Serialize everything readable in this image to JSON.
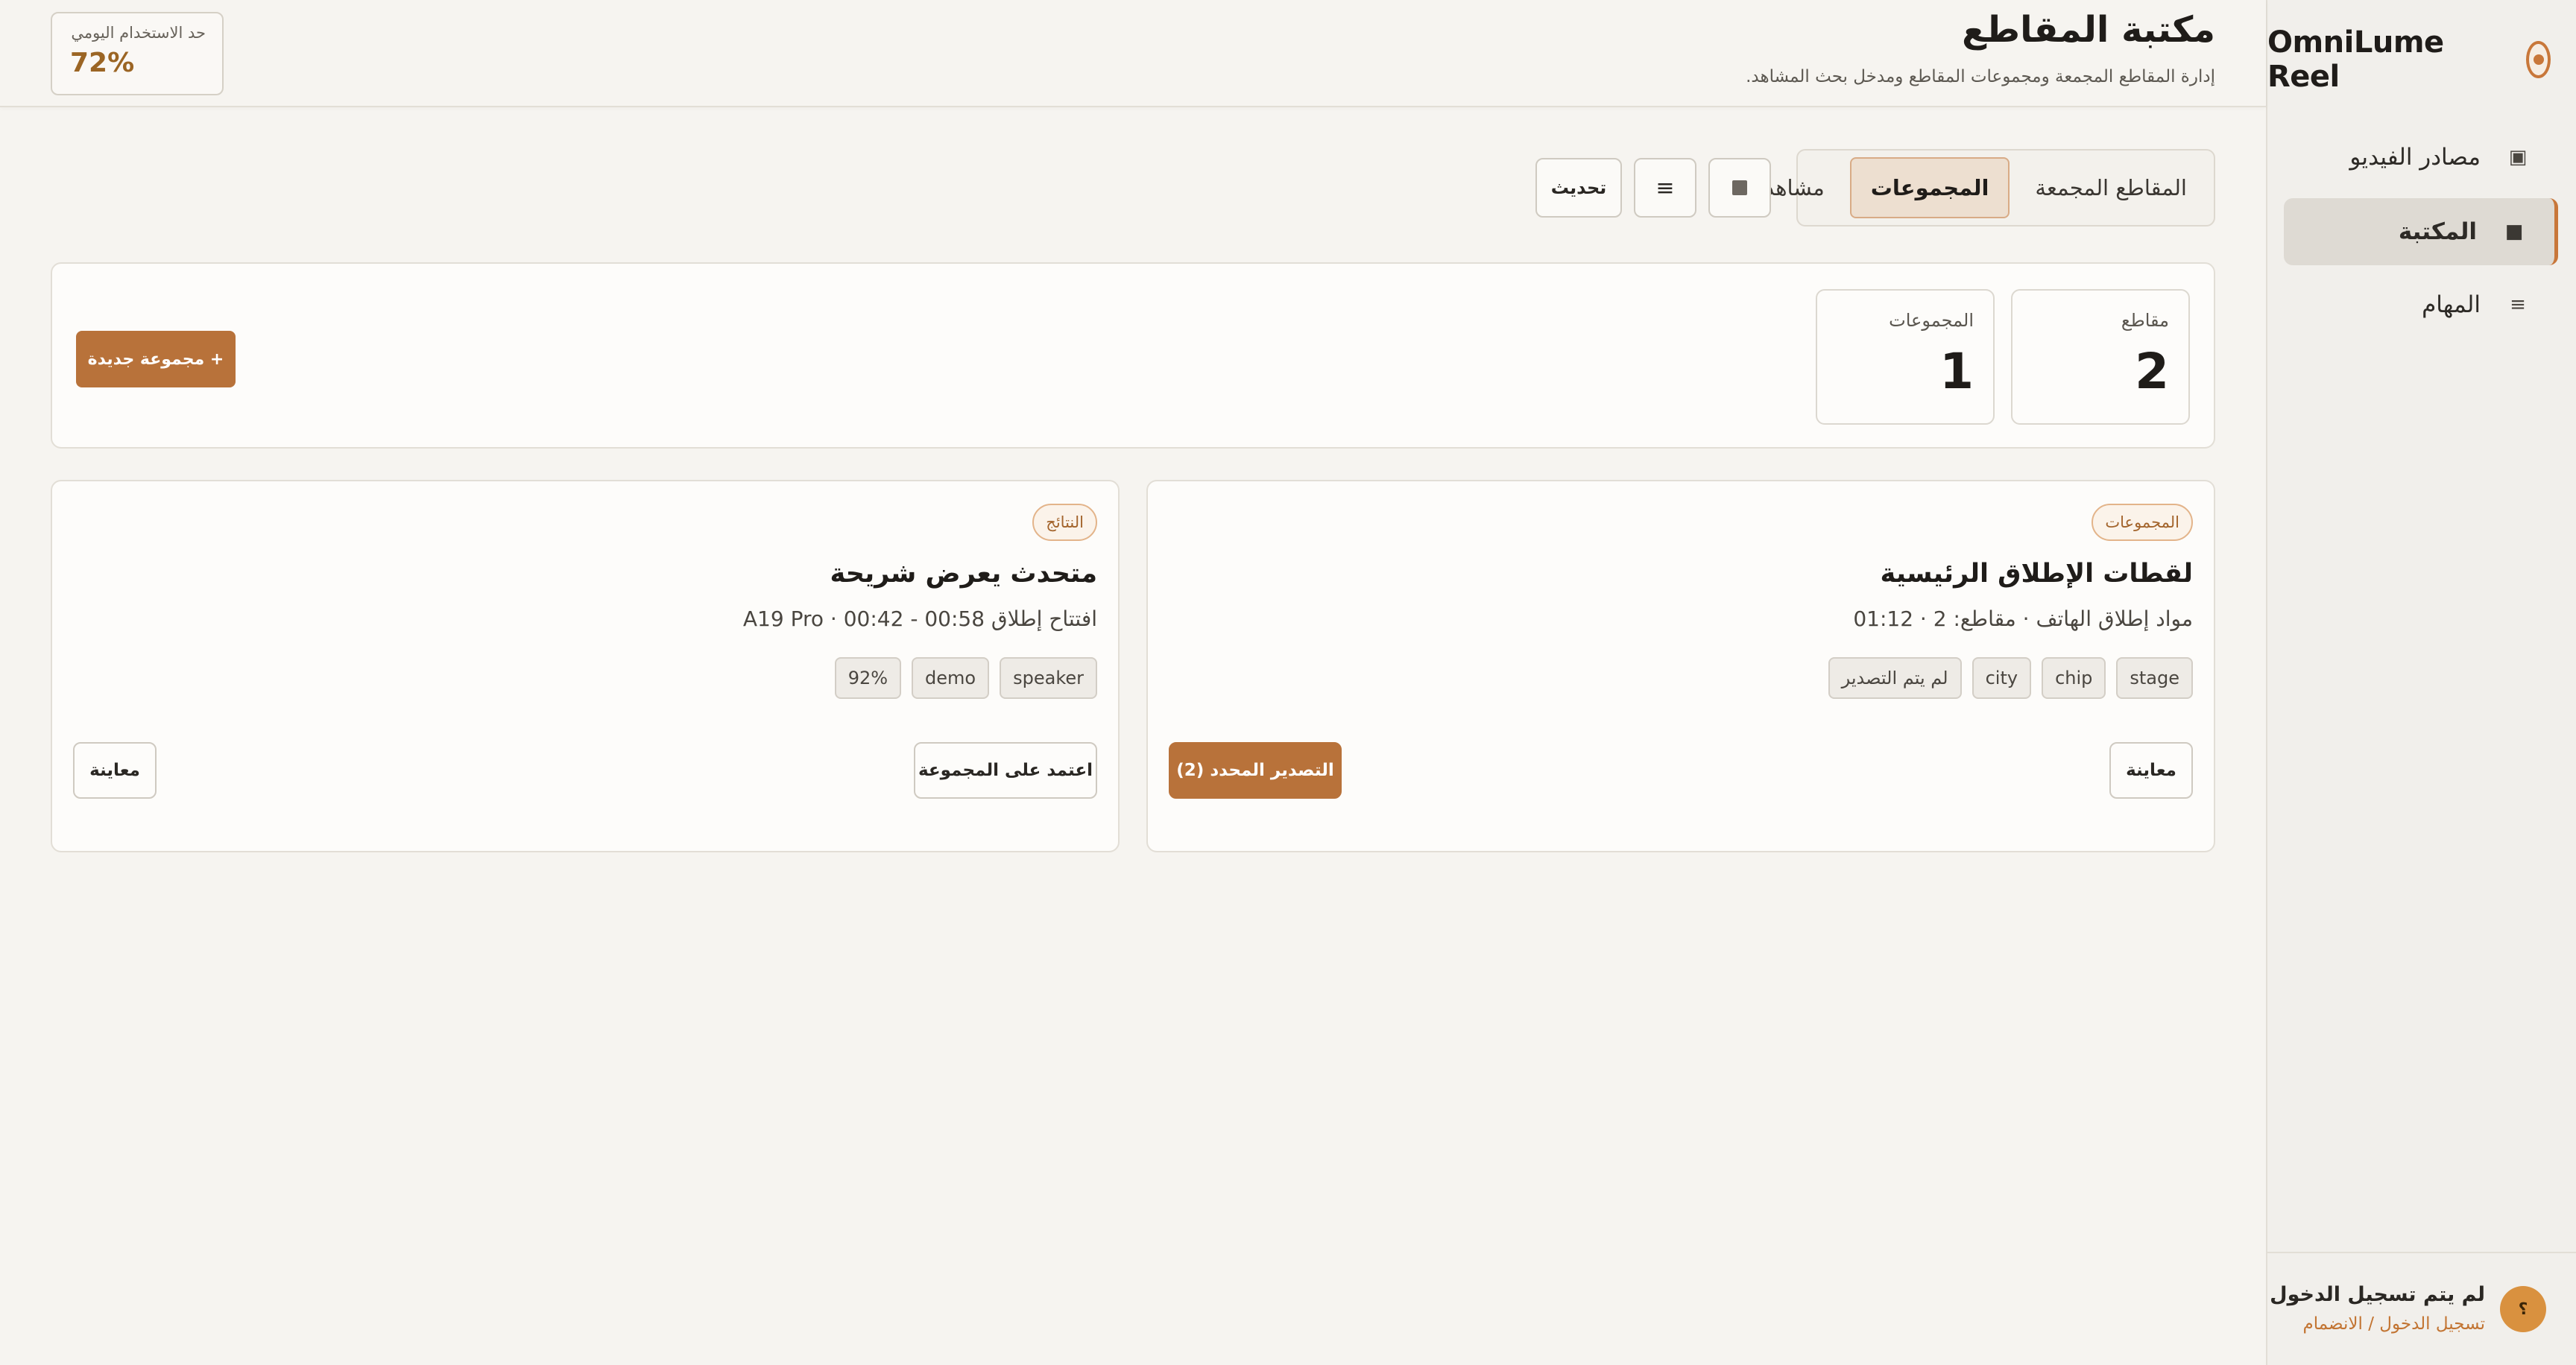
{
  "app": {
    "brand_name": "OmniLume Reel",
    "brand_icon": "lens-icon"
  },
  "sidebar": {
    "items": [
      {
        "label": "مصادر الفيديو",
        "icon": "▣"
      },
      {
        "label": "المكتبة",
        "icon": "■",
        "active": true
      },
      {
        "label": "المهام",
        "icon": "≡"
      }
    ],
    "user": {
      "avatar": "؟",
      "name": "لم يتم تسجيل الدخول",
      "login_link": "تسجيل الدخول / الانضمام"
    }
  },
  "header": {
    "title": "مكتبة المقاطع",
    "subtitle": "إدارة المقاطع المجمعة ومجموعات المقاطع ومدخل بحث المشاهد.",
    "usage_label": "حد الاستخدام اليومي",
    "usage_value": "72%"
  },
  "toolbar": {
    "tabs": [
      {
        "label": "المقاطع المجمعة"
      },
      {
        "label": "المجموعات",
        "active": true
      },
      {
        "label": "مشاهد"
      }
    ],
    "grid_icon": "grid-view-icon",
    "list_icon": "≡",
    "refresh_label": "تحديث"
  },
  "stats": {
    "clips_label": "مقاطع",
    "clips_value": "2",
    "groups_label": "المجموعات",
    "groups_value": "1",
    "new_group_label": "+ مجموعة جديدة"
  },
  "cards": [
    {
      "badge": "المجموعات",
      "title": "لقطات الإطلاق الرئيسية",
      "meta": "مواد إطلاق الهاتف · مقاطع: 2 · 01:12",
      "tags": [
        "stage",
        "chip",
        "city",
        "لم يتم التصدير"
      ],
      "preview_label": "معاينة",
      "export_label": "التصدير المحدد (2)"
    },
    {
      "badge": "النتائج",
      "title": "متحدث يعرض شريحة",
      "meta": "افتتاح إطلاق 00:58 - 00:42 · A19 Pro",
      "tags": [
        "speaker",
        "demo",
        "92%"
      ],
      "approve_label": "اعتمد على المجموعة",
      "preview_label": "معاينة"
    }
  ],
  "colors": {
    "accent": "#b8723a",
    "background": "#f6f4f0",
    "badge_text": "#a3642c"
  }
}
